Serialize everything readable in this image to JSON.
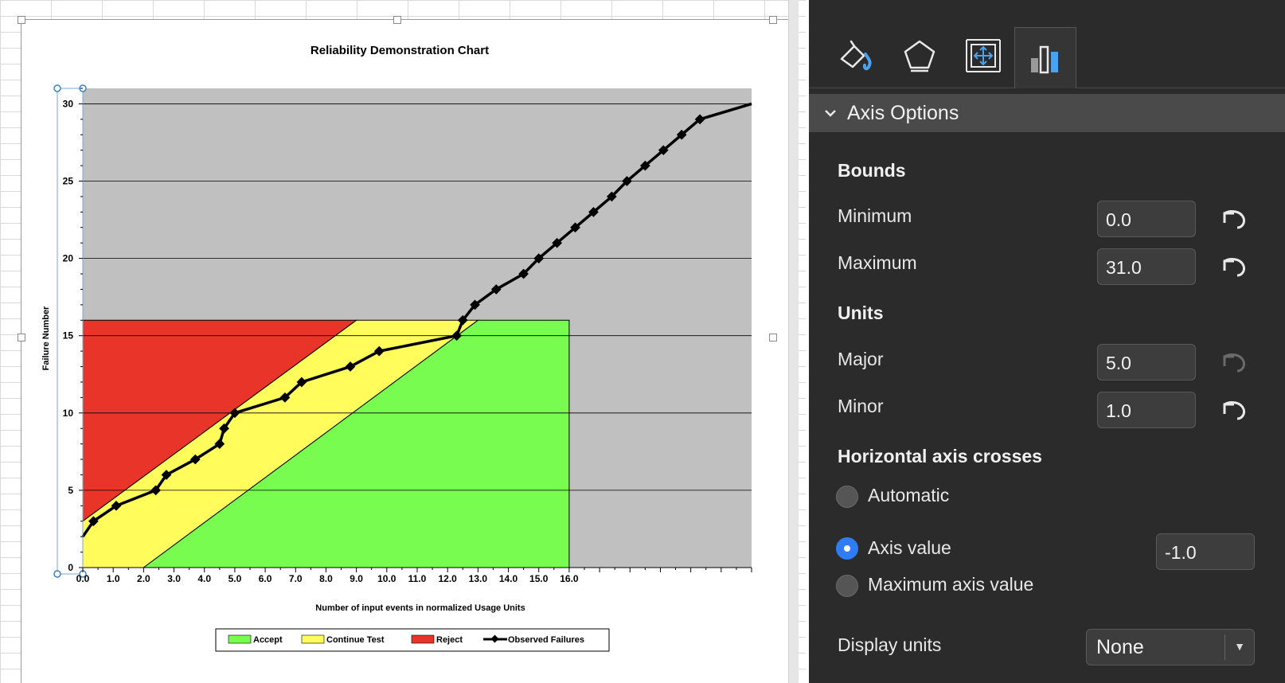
{
  "chart": {
    "title": "Reliability Demonstration Chart",
    "ylabel": "Failure Number",
    "xlabel": "Number of input events in normalized Usage Units",
    "legend": [
      "Accept",
      "Continue Test",
      "Reject",
      "Observed Failures"
    ]
  },
  "chart_data": {
    "type": "line",
    "title": "Reliability Demonstration Chart",
    "xlabel": "Number of input events in normalized Usage Units",
    "ylabel": "Failure Number",
    "ylim": [
      0,
      31
    ],
    "xlim": [
      0,
      22
    ],
    "y_major": 5,
    "y_minor": 1,
    "x_tick_labels": [
      "0.0",
      "1.0",
      "2.0",
      "3.0",
      "4.0",
      "5.0",
      "6.0",
      "7.0",
      "8.0",
      "9.0",
      "10.0",
      "11.0",
      "12.0",
      "13.0",
      "14.0",
      "15.0",
      "16.0"
    ],
    "y_tick_labels": [
      "0",
      "5",
      "10",
      "15",
      "20",
      "25",
      "30"
    ],
    "grid": true,
    "legend_position": "bottom",
    "colors": {
      "plot_background": "#c0c0c0",
      "accept": "#77fc4f",
      "continue": "#fffc5c",
      "reject": "#e9342a",
      "observed": "#000000"
    },
    "regions": [
      {
        "name": "Reject",
        "polygon": [
          [
            0,
            3
          ],
          [
            0,
            16
          ],
          [
            9,
            16
          ]
        ]
      },
      {
        "name": "Continue Test",
        "polygon": [
          [
            0,
            0
          ],
          [
            0,
            3
          ],
          [
            9,
            16
          ],
          [
            13,
            16
          ],
          [
            2,
            0
          ]
        ]
      },
      {
        "name": "Accept",
        "polygon": [
          [
            2,
            0
          ],
          [
            13,
            16
          ],
          [
            16,
            16
          ],
          [
            16,
            0
          ]
        ]
      }
    ],
    "series": [
      {
        "name": "Observed Failures",
        "x": [
          0.0,
          0.35,
          1.1,
          2.4,
          2.75,
          3.7,
          4.5,
          4.65,
          5.0,
          6.65,
          7.2,
          8.8,
          9.75,
          12.3,
          12.5,
          12.9,
          13.6,
          14.5,
          15.0,
          15.6,
          16.2,
          16.8,
          17.4,
          17.9,
          18.5,
          19.1,
          19.7,
          20.3,
          22.0
        ],
        "y": [
          2,
          3,
          4,
          5,
          6,
          7,
          8,
          9,
          10,
          11,
          12,
          13,
          14,
          15,
          16,
          17,
          18,
          19,
          20,
          21,
          22,
          23,
          24,
          25,
          26,
          27,
          28,
          29,
          30
        ]
      }
    ]
  },
  "pane": {
    "section_title": "Axis Options",
    "bounds": {
      "title": "Bounds",
      "minimum_label": "Minimum",
      "minimum_value": "0.0",
      "maximum_label": "Maximum",
      "maximum_value": "31.0"
    },
    "units": {
      "title": "Units",
      "major_label": "Major",
      "major_value": "5.0",
      "minor_label": "Minor",
      "minor_value": "1.0"
    },
    "crosses": {
      "title": "Horizontal axis crosses",
      "automatic_label": "Automatic",
      "axis_value_label": "Axis value",
      "axis_value": "-1.0",
      "max_label": "Maximum axis value"
    },
    "display_units": {
      "label": "Display units",
      "value": "None"
    },
    "colors": {
      "background": "#2b2b2b",
      "header": "#4a4a4a",
      "accent": "#2f7cf6",
      "icon_blue": "#4aa3f0"
    },
    "tab_icons": [
      "fill-line-icon",
      "effects-icon",
      "size-properties-icon",
      "axis-options-icon"
    ]
  }
}
